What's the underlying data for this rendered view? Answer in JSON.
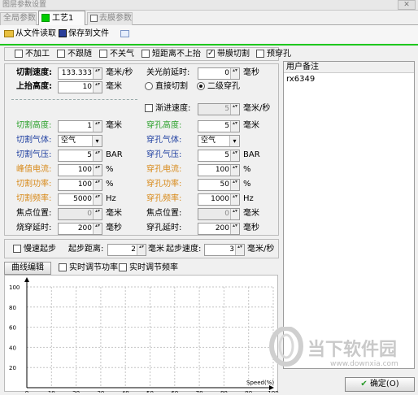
{
  "window": {
    "title": "图层参数设置",
    "close": "✕"
  },
  "tabs": [
    {
      "label": "全局参数"
    },
    {
      "label": "工艺1"
    },
    {
      "label": "去膜参数"
    }
  ],
  "toolbar": {
    "read_label": "从文件读取",
    "save_label": "保存到文件"
  },
  "options": [
    {
      "label": "不加工",
      "checked": false
    },
    {
      "label": "不跟随",
      "checked": false
    },
    {
      "label": "不关气",
      "checked": false
    },
    {
      "label": "短距离不上抬",
      "checked": false
    },
    {
      "label": "带膜切割",
      "checked": true
    },
    {
      "label": "预穿孔",
      "checked": false
    }
  ],
  "cut_speed": {
    "label": "切割速度:",
    "value": "133.333",
    "unit": "毫米/秒"
  },
  "lift_height": {
    "label": "上抬高度:",
    "value": "10",
    "unit": "毫米"
  },
  "light_delay": {
    "label": "关光前延时:",
    "value": "0",
    "unit": "毫秒"
  },
  "pierce_mode": {
    "direct": "直接切割",
    "secondary": "二级穿孔",
    "selected": "secondary"
  },
  "gradual": {
    "label": "渐进速度:",
    "value": "5",
    "unit": "毫米/秒",
    "checked": false
  },
  "left_params": [
    {
      "label": "切割高度:",
      "value": "1",
      "unit": "毫米",
      "type": "spin",
      "color": "#2aa02a"
    },
    {
      "label": "切割气体:",
      "value": "空气",
      "unit": "",
      "type": "select",
      "color": "#1f3fa0"
    },
    {
      "label": "切割气压:",
      "value": "5",
      "unit": "BAR",
      "type": "spin",
      "color": "#1f3fa0"
    },
    {
      "label": "峰值电流:",
      "value": "100",
      "unit": "%",
      "type": "spin",
      "color": "#d88a1a"
    },
    {
      "label": "切割功率:",
      "value": "100",
      "unit": "%",
      "type": "spin",
      "color": "#d88a1a"
    },
    {
      "label": "切割频率:",
      "value": "5000",
      "unit": "Hz",
      "type": "spin",
      "color": "#d88a1a"
    },
    {
      "label": "焦点位置:",
      "value": "0",
      "unit": "毫米",
      "type": "spin-dis",
      "color": "#000000"
    },
    {
      "label": "烧穿延时:",
      "value": "200",
      "unit": "毫秒",
      "type": "spin",
      "color": "#000000"
    }
  ],
  "right_params": [
    {
      "label": "穿孔高度:",
      "value": "5",
      "unit": "毫米",
      "type": "spin",
      "color": "#2aa02a"
    },
    {
      "label": "穿孔气体:",
      "value": "空气",
      "unit": "",
      "type": "select",
      "color": "#1f3fa0"
    },
    {
      "label": "穿孔气压:",
      "value": "5",
      "unit": "BAR",
      "type": "spin",
      "color": "#1f3fa0"
    },
    {
      "label": "穿孔电流:",
      "value": "100",
      "unit": "%",
      "type": "spin",
      "color": "#d88a1a"
    },
    {
      "label": "穿孔功率:",
      "value": "50",
      "unit": "%",
      "type": "spin",
      "color": "#d88a1a"
    },
    {
      "label": "穿孔频率:",
      "value": "1000",
      "unit": "Hz",
      "type": "spin",
      "color": "#d88a1a"
    },
    {
      "label": "焦点位置:",
      "value": "0",
      "unit": "毫米",
      "type": "spin-dis",
      "color": "#000000"
    },
    {
      "label": "穿孔延时:",
      "value": "200",
      "unit": "毫秒",
      "type": "spin",
      "color": "#000000"
    }
  ],
  "slow_start": {
    "label": "慢速起步",
    "checked": false,
    "dist_label": "起步距离:",
    "dist_value": "2",
    "dist_unit": "毫米",
    "speed_label": "起步速度:",
    "speed_value": "3",
    "speed_unit": "毫米/秒"
  },
  "curve": {
    "button": "曲线编辑",
    "rt_power": "实时调节功率",
    "rt_freq": "实时调节频率"
  },
  "chart_data": {
    "type": "line",
    "title": "",
    "xlabel": "Speed(%)",
    "ylabel": "",
    "xlim": [
      0,
      100
    ],
    "ylim": [
      0,
      100
    ],
    "xticks": [
      "0",
      "10",
      "20",
      "30",
      "40",
      "50",
      "60",
      "70",
      "80",
      "90",
      "100"
    ],
    "yticks": [
      "100",
      "80",
      "60",
      "40",
      "20"
    ],
    "grid": true,
    "series": []
  },
  "remarks": {
    "title": "用户备注",
    "text": "rx6349"
  },
  "confirm_label": "确定(O)",
  "watermark": {
    "name": "当下软件园",
    "url": "www.downxia.com"
  }
}
